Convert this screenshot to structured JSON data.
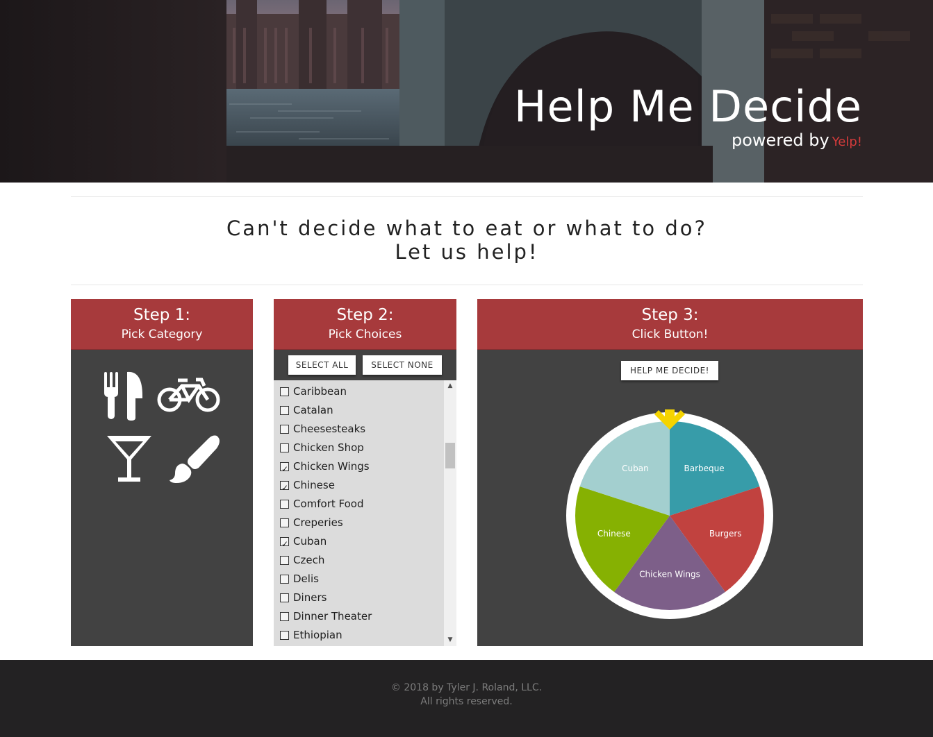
{
  "hero": {
    "title": "Help Me Decide",
    "powered_by": "powered by",
    "yelp": "Yelp!"
  },
  "intro": {
    "line1": "Can't decide what to eat or what to do?",
    "line2": "Let us help!"
  },
  "step1": {
    "step": "Step 1:",
    "subtitle": "Pick Category",
    "icons": [
      "fork-knife-icon",
      "bicycle-icon",
      "cocktail-icon",
      "paintbrush-icon"
    ]
  },
  "step2": {
    "step": "Step 2:",
    "subtitle": "Pick Choices",
    "select_all": "SELECT ALL",
    "select_none": "SELECT NONE",
    "items": [
      {
        "label": "Caribbean",
        "checked": false
      },
      {
        "label": "Catalan",
        "checked": false
      },
      {
        "label": "Cheesesteaks",
        "checked": false
      },
      {
        "label": "Chicken Shop",
        "checked": false
      },
      {
        "label": "Chicken Wings",
        "checked": true
      },
      {
        "label": "Chinese",
        "checked": true
      },
      {
        "label": "Comfort Food",
        "checked": false
      },
      {
        "label": "Creperies",
        "checked": false
      },
      {
        "label": "Cuban",
        "checked": true
      },
      {
        "label": "Czech",
        "checked": false
      },
      {
        "label": "Delis",
        "checked": false
      },
      {
        "label": "Diners",
        "checked": false
      },
      {
        "label": "Dinner Theater",
        "checked": false
      },
      {
        "label": "Ethiopian",
        "checked": false
      }
    ]
  },
  "step3": {
    "step": "Step 3:",
    "subtitle": "Click Button!",
    "decide_button": "HELP ME DECIDE!",
    "wheel": [
      {
        "label": "Barbeque",
        "color": "#379ca9"
      },
      {
        "label": "Burgers",
        "color": "#c1423f"
      },
      {
        "label": "Chicken Wings",
        "color": "#7d5f89"
      },
      {
        "label": "Chinese",
        "color": "#86b102"
      },
      {
        "label": "Cuban",
        "color": "#a3cfcf"
      }
    ],
    "pointer_color": "#f5d400"
  },
  "footer": {
    "copyright": "© 2018 by Tyler J. Roland, LLC.",
    "rights": "All rights reserved."
  }
}
